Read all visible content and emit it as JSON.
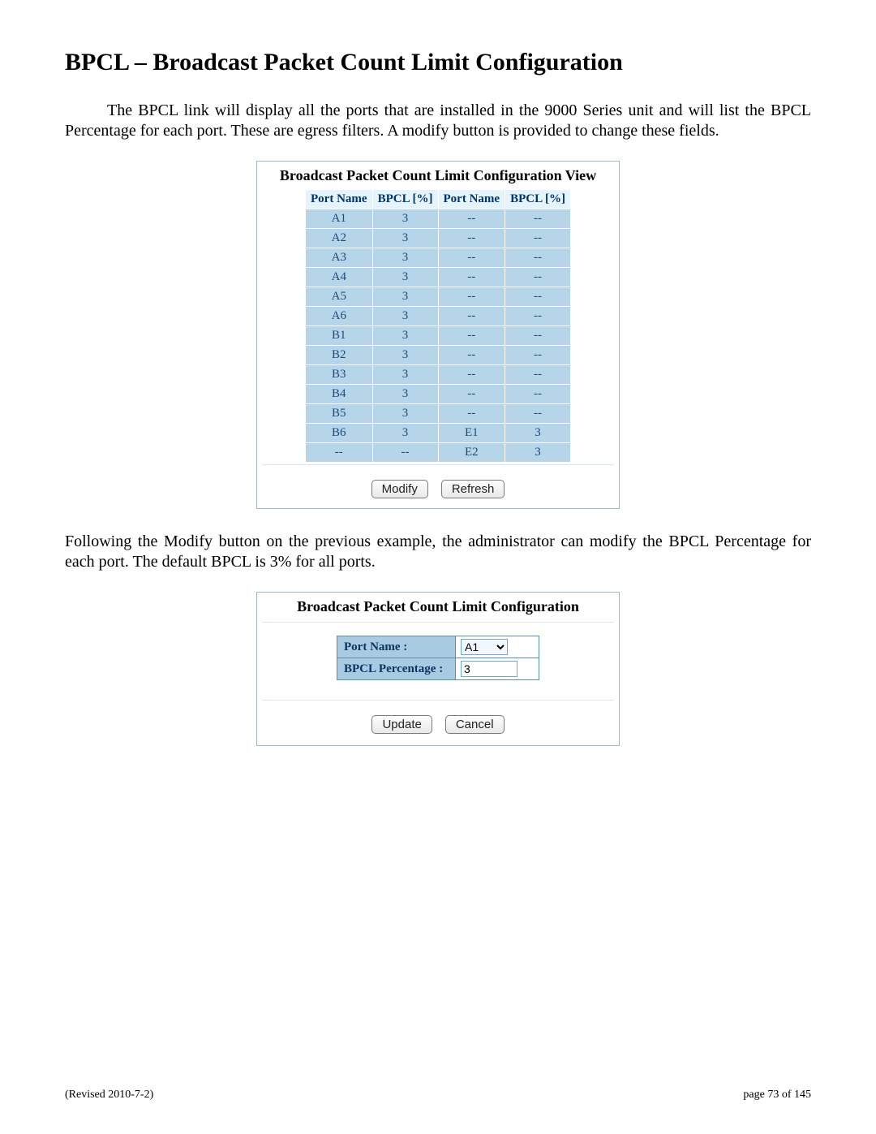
{
  "header": {
    "title": "BPCL – Broadcast Packet Count Limit Configuration"
  },
  "intro_paragraph": "The BPCL link will display all the ports that are installed in the 9000 Series unit and will list the BPCL Percentage for each port.  These are egress filters.  A modify button is provided to change these fields.",
  "view_panel": {
    "title": "Broadcast Packet Count Limit Configuration View",
    "columns": {
      "c1": "Port Name",
      "c2": "BPCL [%]",
      "c3": "Port Name",
      "c4": "BPCL [%]"
    },
    "rows": [
      {
        "pn1": "A1",
        "v1": "3",
        "pn2": "--",
        "v2": "--"
      },
      {
        "pn1": "A2",
        "v1": "3",
        "pn2": "--",
        "v2": "--"
      },
      {
        "pn1": "A3",
        "v1": "3",
        "pn2": "--",
        "v2": "--"
      },
      {
        "pn1": "A4",
        "v1": "3",
        "pn2": "--",
        "v2": "--"
      },
      {
        "pn1": "A5",
        "v1": "3",
        "pn2": "--",
        "v2": "--"
      },
      {
        "pn1": "A6",
        "v1": "3",
        "pn2": "--",
        "v2": "--"
      },
      {
        "pn1": "B1",
        "v1": "3",
        "pn2": "--",
        "v2": "--"
      },
      {
        "pn1": "B2",
        "v1": "3",
        "pn2": "--",
        "v2": "--"
      },
      {
        "pn1": "B3",
        "v1": "3",
        "pn2": "--",
        "v2": "--"
      },
      {
        "pn1": "B4",
        "v1": "3",
        "pn2": "--",
        "v2": "--"
      },
      {
        "pn1": "B5",
        "v1": "3",
        "pn2": "--",
        "v2": "--"
      },
      {
        "pn1": "B6",
        "v1": "3",
        "pn2": "E1",
        "v2": "3"
      },
      {
        "pn1": "--",
        "v1": "--",
        "pn2": "E2",
        "v2": "3"
      }
    ],
    "buttons": {
      "modify": "Modify",
      "refresh": "Refresh"
    }
  },
  "mid_paragraph": "Following the Modify button on the previous example, the administrator can modify the BPCL Percentage for each port.  The default BPCL is 3% for all ports.",
  "edit_panel": {
    "title": "Broadcast Packet Count Limit Configuration",
    "labels": {
      "port_name": "Port Name :",
      "bpcl_pct": "BPCL Percentage :"
    },
    "port_selected": "A1",
    "bpcl_value": "3",
    "buttons": {
      "update": "Update",
      "cancel": "Cancel"
    }
  },
  "footer": {
    "left": "(Revised 2010-7-2)",
    "right": "page 73 of 145"
  }
}
